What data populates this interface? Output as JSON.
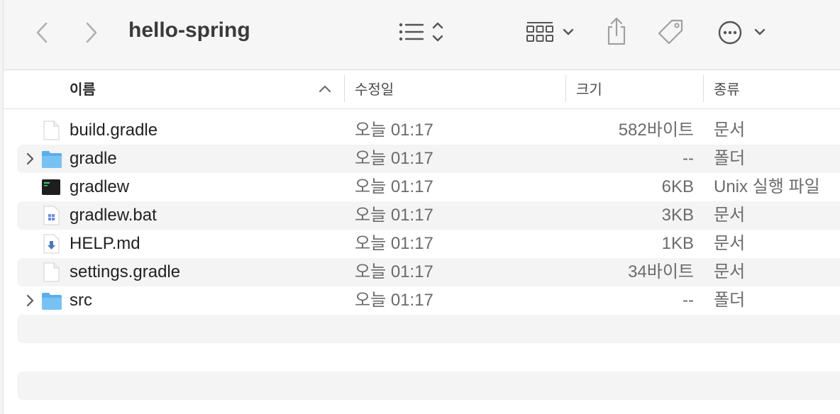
{
  "window": {
    "title": "hello-spring"
  },
  "toolbar": {
    "back_icon": "chevron-left-icon",
    "forward_icon": "chevron-right-icon",
    "view_icon": "list-view-icon",
    "group_icon": "group-grid-icon",
    "share_icon": "share-icon",
    "tag_icon": "tag-icon",
    "more_icon": "ellipsis-circle-icon"
  },
  "columns": {
    "name": "이름",
    "date": "수정일",
    "size": "크기",
    "kind": "종류"
  },
  "files": [
    {
      "name": "build.gradle",
      "date": "오늘 01:17",
      "size": "582바이트",
      "kind": "문서",
      "icon": "document-icon",
      "expandable": false
    },
    {
      "name": "gradle",
      "date": "오늘 01:17",
      "size": "--",
      "kind": "폴더",
      "icon": "folder-icon",
      "expandable": true
    },
    {
      "name": "gradlew",
      "date": "오늘 01:17",
      "size": "6KB",
      "kind": "Unix 실행 파일",
      "icon": "terminal-exec-icon",
      "expandable": false
    },
    {
      "name": "gradlew.bat",
      "date": "오늘 01:17",
      "size": "3KB",
      "kind": "문서",
      "icon": "windows-doc-icon",
      "expandable": false
    },
    {
      "name": "HELP.md",
      "date": "오늘 01:17",
      "size": "1KB",
      "kind": "문서",
      "icon": "markdown-doc-icon",
      "expandable": false
    },
    {
      "name": "settings.gradle",
      "date": "오늘 01:17",
      "size": "34바이트",
      "kind": "문서",
      "icon": "document-icon",
      "expandable": false
    },
    {
      "name": "src",
      "date": "오늘 01:17",
      "size": "--",
      "kind": "폴더",
      "icon": "folder-icon",
      "expandable": true
    }
  ],
  "colors": {
    "folder": "#6cb8ef",
    "alt_row": "#f4f4f4",
    "toolbar_bg": "#f6f6f6"
  }
}
